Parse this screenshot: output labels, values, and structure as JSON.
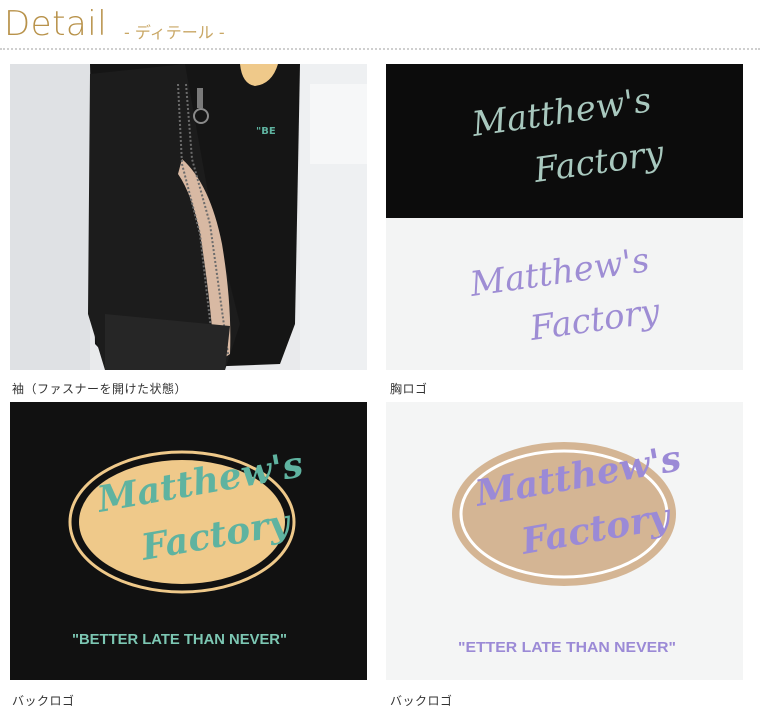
{
  "header": {
    "title": "Detail",
    "subtitle": "- ディテール -"
  },
  "panels": [
    {
      "caption": "袖（ファスナーを開けた状態）"
    },
    {
      "caption": "胸ロゴ"
    },
    {
      "caption": "バックロゴ"
    },
    {
      "caption": "バックロゴ"
    }
  ],
  "logos": {
    "chest_black": {
      "line1": "Matthew's",
      "line2": "Factory"
    },
    "chest_white": {
      "line1": "Matthew's",
      "line2": "Factory"
    },
    "back_black": {
      "line1": "Matthew's",
      "line2": "Factory",
      "slogan": "\"BETTER LATE THAN NEVER\""
    },
    "back_white": {
      "line1": "Matthew's",
      "line2": "Factory",
      "slogan": "\"ETTER LATE THAN NEVER\""
    }
  },
  "colors": {
    "title": "#b8924a",
    "mint": "#5fb3a0",
    "lavender": "#9b8ad6",
    "oval_yellow": "#efc98a",
    "oval_tan": "#d4b594"
  }
}
